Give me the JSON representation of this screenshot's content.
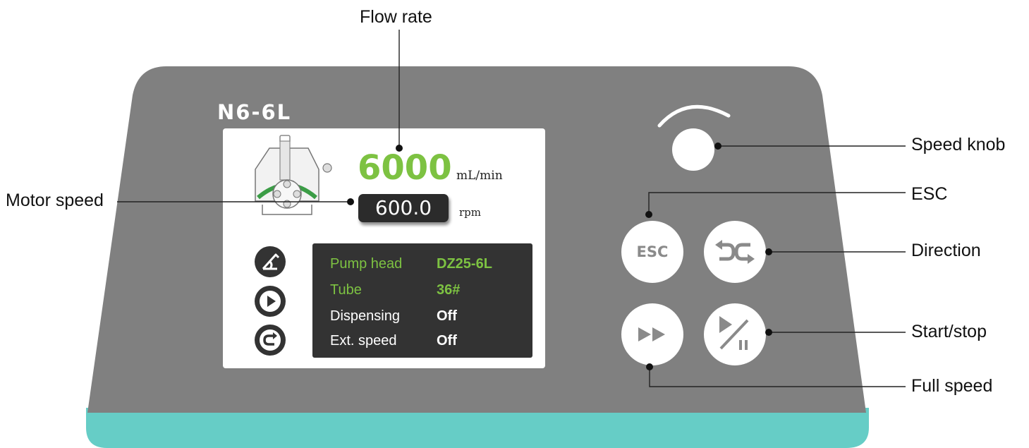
{
  "device": {
    "model": "N6-6L",
    "colors": {
      "body": "#808080",
      "base_stripe": "#66cdc6",
      "accent_green": "#7dc242",
      "dark_panel": "#333333"
    }
  },
  "screen": {
    "flow_value": "6000",
    "flow_unit": "mL/min",
    "speed_value": "600.0",
    "speed_unit": "rpm",
    "info_rows": [
      {
        "key": "Pump head",
        "value": "DZ25-6L"
      },
      {
        "key": "Tube",
        "value": "36#"
      },
      {
        "key": "Dispensing",
        "value": "Off"
      },
      {
        "key": "Ext. speed",
        "value": "Off"
      }
    ],
    "side_icons": [
      "calibration-icon",
      "run-icon",
      "direction-icon"
    ],
    "illustration": "pump-head-icon"
  },
  "buttons": {
    "esc_label": "ESC",
    "direction_icon": "direction-arrows-icon",
    "full_speed_icon": "fast-forward-icon",
    "start_stop_icon": "play-pause-icon",
    "knob_icon": "speed-knob"
  },
  "callouts": {
    "flow_rate": "Flow rate",
    "motor_speed": "Motor speed",
    "speed_knob": "Speed knob",
    "esc": "ESC",
    "direction": "Direction",
    "start_stop": "Start/stop",
    "full_speed": "Full speed"
  }
}
